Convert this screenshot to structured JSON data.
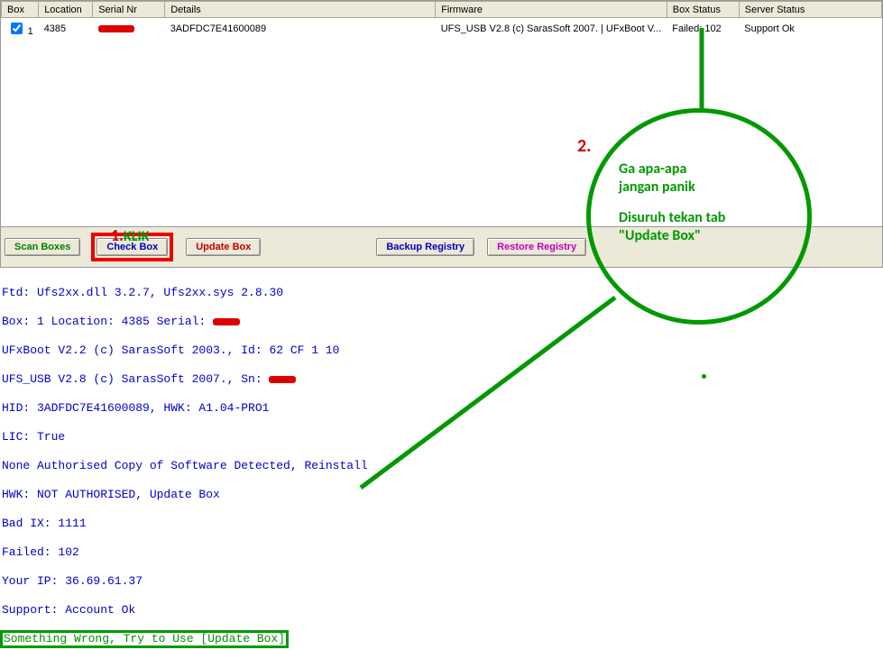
{
  "table": {
    "headers": [
      "Box",
      "Location",
      "Serial Nr",
      "Details",
      "Firmware",
      "Box Status",
      "Server Status"
    ],
    "row": {
      "box": "1",
      "location": "4385",
      "details": "3ADFDC7E41600089",
      "firmware": "UFS_USB V2.8 (c) SarasSoft 2007. | UFxBoot V...",
      "box_status": "Failed: 102",
      "server_status": "Support Ok"
    }
  },
  "buttons": {
    "scan": "Scan Boxes",
    "check": "Check Box",
    "update": "Update Box",
    "backup": "Backup Registry",
    "restore": "Restore Registry"
  },
  "annotations": {
    "klik_num": "1.",
    "klik_text": "KLIK",
    "two": "2.",
    "line1": "Ga apa-apa",
    "line2": "jangan panik",
    "line3": "Disuruh tekan tab",
    "line4": "\"Update Box\""
  },
  "console": {
    "l1": "Ftd: Ufs2xx.dll 3.2.7, Ufs2xx.sys 2.8.30",
    "l2a": "Box: 1 Location: 4385 Serial: ",
    "l3": "UFxBoot V2.2 (c) SarasSoft 2003., Id: 62 CF 1 10",
    "l4a": "UFS_USB V2.8 (c) SarasSoft 2007., Sn: ",
    "l5": "HID: 3ADFDC7E41600089, HWK: A1.04-PRO1",
    "l6": "LIC: True",
    "l7": "None Authorised Copy of Software Detected, Reinstall",
    "l8": "HWK: NOT AUTHORISED, Update Box",
    "l9": "Bad IX: 1111",
    "l10": "Failed: 102",
    "l11": "Your IP: 36.69.61.37",
    "l12": "Support: Account Ok",
    "l13": "Something Wrong, Try to Use [Update Box]"
  }
}
